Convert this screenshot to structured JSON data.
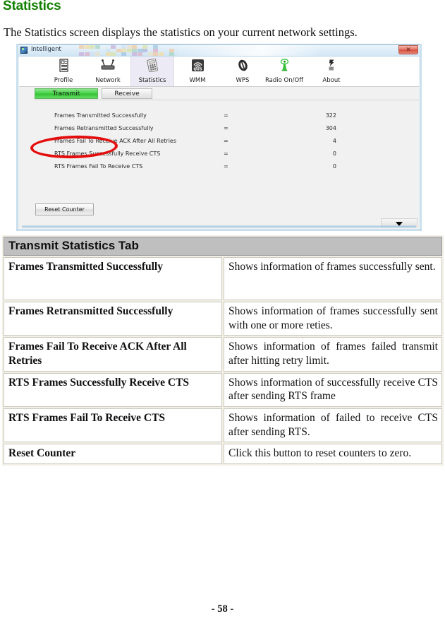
{
  "page": {
    "title": "Statistics",
    "title_color": "#128000",
    "intro": "The Statistics screen displays the statistics on your current network settings.",
    "footer": "- 58 -"
  },
  "app_window": {
    "title": "Intelligent",
    "close_label": "✕",
    "toolbar": [
      {
        "label": "Profile",
        "icon": "profile-icon",
        "selected": false
      },
      {
        "label": "Network",
        "icon": "network-icon",
        "selected": false
      },
      {
        "label": "Statistics",
        "icon": "statistics-icon",
        "selected": true
      },
      {
        "label": "WMM",
        "icon": "wmm-qos-icon",
        "selected": false
      },
      {
        "label": "WPS",
        "icon": "wps-icon",
        "selected": false
      },
      {
        "label": "Radio On/Off",
        "icon": "radio-icon",
        "selected": false
      },
      {
        "label": "About",
        "icon": "about-icon",
        "selected": false
      }
    ],
    "tabs": [
      {
        "label": "Transmit",
        "active": true
      },
      {
        "label": "Receive",
        "active": false
      }
    ],
    "active_tab_color": "#3cc83c",
    "stats": [
      {
        "name": "Frames Transmitted Successfully",
        "sep": "=",
        "value": "322"
      },
      {
        "name": "Frames Retransmitted Successfully",
        "sep": "=",
        "value": "304"
      },
      {
        "name": "Frames Fail To Receive ACK After All Retries",
        "sep": "=",
        "value": "4"
      },
      {
        "name": "RTS Frames Successfully Receive CTS",
        "sep": "=",
        "value": "0"
      },
      {
        "name": "RTS Frames Fail To Receive CTS",
        "sep": "=",
        "value": "0"
      }
    ],
    "reset_button": "Reset Counter"
  },
  "annotation": {
    "shape": "red-oval",
    "color": "#e50e0e",
    "targets": "Transmit tab"
  },
  "table": {
    "header": "Transmit Statistics Tab",
    "rows": [
      {
        "term": "Frames Transmitted Successfully",
        "definition": "Shows information of frames successfully sent."
      },
      {
        "term": "Frames Retransmitted Successfully",
        "definition": "Shows information of frames successfully sent with one or more reties."
      },
      {
        "term": "Frames Fail To Receive ACK After All Retries",
        "definition": "Shows information of frames failed transmit after hitting retry limit."
      },
      {
        "term": "RTS Frames Successfully Receive CTS",
        "definition": "Shows information of successfully receive CTS after sending RTS frame"
      },
      {
        "term": "RTS Frames Fail To Receive CTS",
        "definition": "Shows information of failed to receive CTS after sending RTS."
      },
      {
        "term": "Reset Counter",
        "definition": "Click this button to reset counters to zero."
      }
    ]
  }
}
